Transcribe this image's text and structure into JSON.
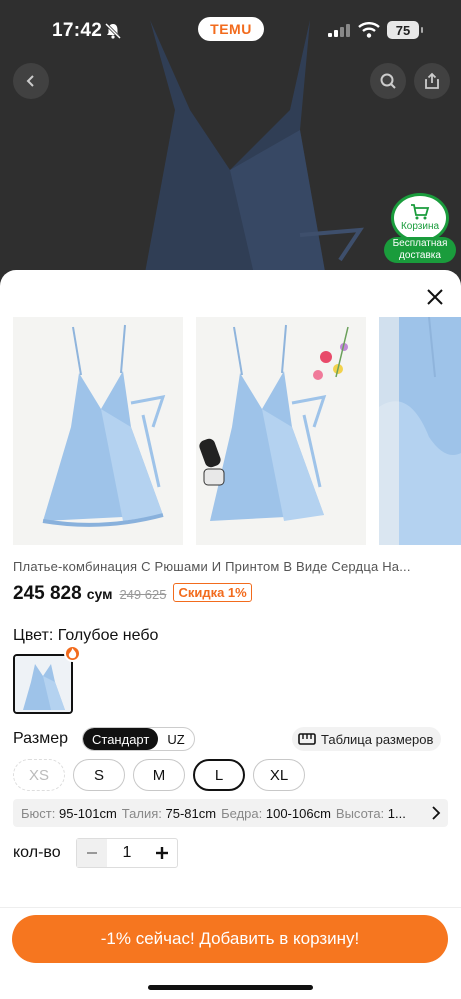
{
  "status_bar": {
    "time": "17:42",
    "battery": "75",
    "brand": "TEMU"
  },
  "floating_cart": {
    "label": "Корзина",
    "free_shipping": "Бесплатная доставка"
  },
  "product": {
    "title": "Платье-комбинация С Рюшами И Принтом В Виде Сердца На...",
    "price": "245 828",
    "currency": "сум",
    "old_price": "249 625",
    "discount": "Скидка 1%"
  },
  "color": {
    "label": "Цвет: Голубое небо"
  },
  "size": {
    "label": "Размер",
    "toggle": [
      "Стандарт",
      "UZ"
    ],
    "active_toggle": "Стандарт",
    "chart_link": "Таблица размеров",
    "options": [
      "XS",
      "S",
      "M",
      "L",
      "XL"
    ],
    "selected": "L",
    "disabled": [
      "XS"
    ]
  },
  "measurements": [
    {
      "key": "Бюст:",
      "value": "95-101cm"
    },
    {
      "key": "Талия:",
      "value": "75-81cm"
    },
    {
      "key": "Бедра:",
      "value": "100-106cm"
    },
    {
      "key": "Высота:",
      "value": "1..."
    }
  ],
  "quantity": {
    "label": "кол-во",
    "value": "1"
  },
  "cta": {
    "label": "-1% сейчас! Добавить в корзину!"
  },
  "colors": {
    "accent": "#f6761f",
    "discount": "#f26b1d",
    "green": "#1a9c3c",
    "dress": "#9ec3e9"
  }
}
